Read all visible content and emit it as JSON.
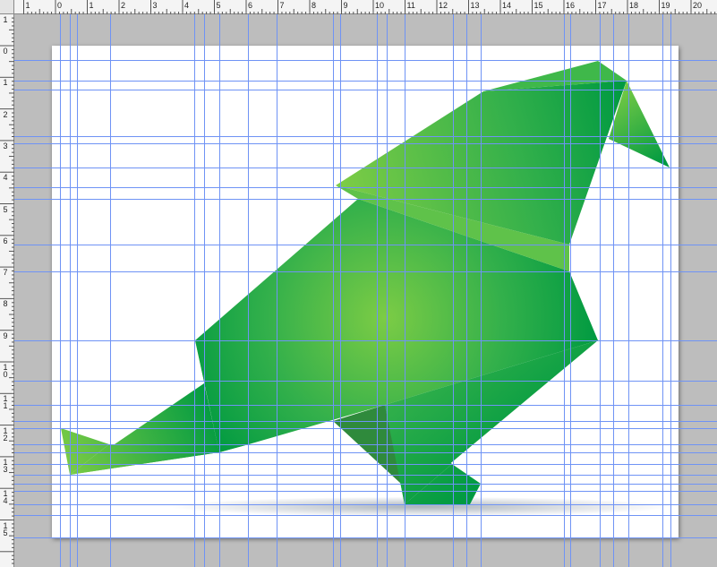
{
  "window": {
    "background_color": "#bdbdbd",
    "page_color": "#ffffff",
    "guide_color": "#6f93f5"
  },
  "rulers": {
    "top": {
      "labels": [
        "1",
        "0",
        "1",
        "2",
        "3",
        "4",
        "5",
        "6",
        "7",
        "8",
        "9",
        "10",
        "11",
        "12",
        "13",
        "14",
        "15",
        "16",
        "17",
        "18",
        "19",
        "20"
      ]
    },
    "left": {
      "labels": [
        "1",
        "0",
        "1",
        "2",
        "3",
        "4",
        "5",
        "6",
        "7",
        "8",
        "9",
        "10",
        "11",
        "12",
        "13",
        "14",
        "15"
      ]
    }
  },
  "artwork": {
    "subject": "green origami bird",
    "colors": {
      "light_green": "#7ccc45",
      "mid_green": "#33b04b",
      "dark_green": "#009a41",
      "shadow": "#8e9aa6"
    }
  },
  "guides": {
    "count_vertical": 24,
    "count_horizontal": 24
  }
}
